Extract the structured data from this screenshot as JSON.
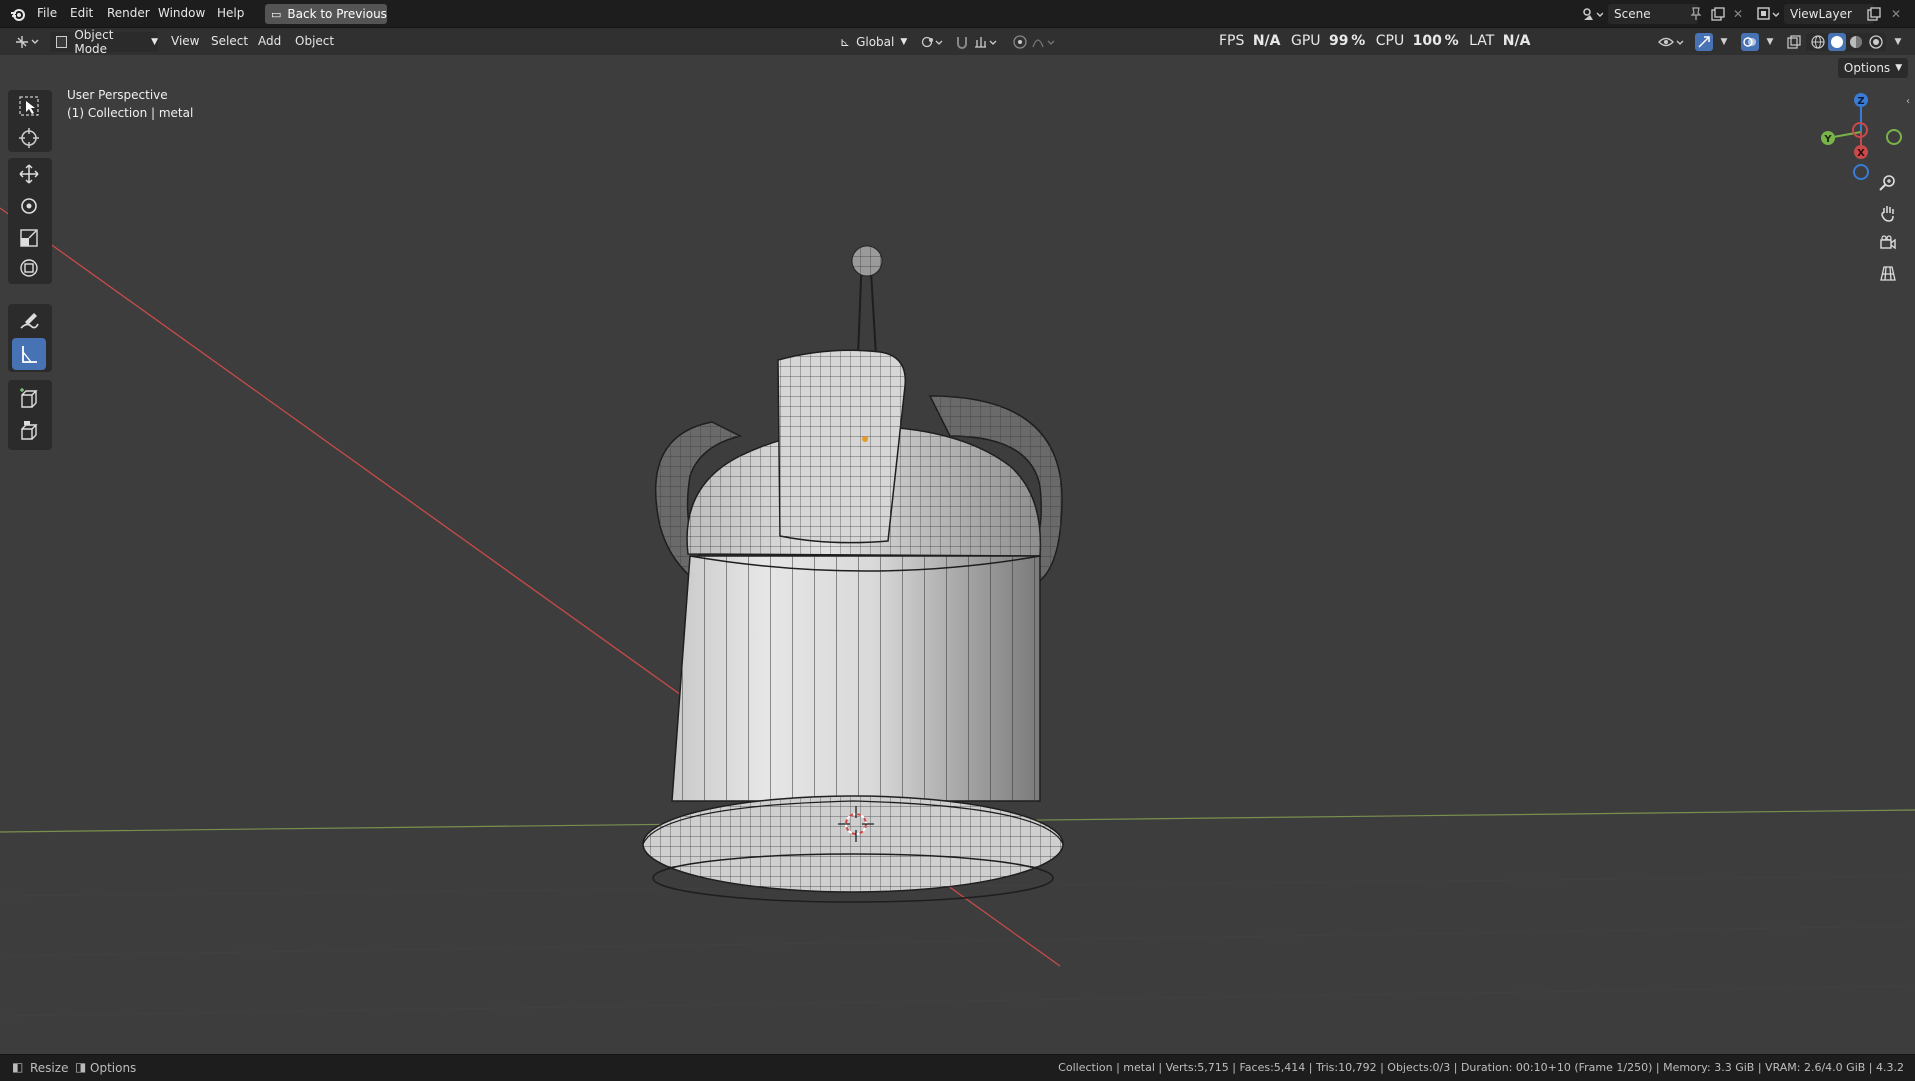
{
  "menubar": {
    "items": [
      "File",
      "Edit",
      "Render",
      "Window",
      "Help"
    ],
    "back_button": "Back to Previous",
    "scene": "Scene",
    "view_layer": "ViewLayer"
  },
  "header": {
    "mode": "Object Mode",
    "menus": [
      "View",
      "Select",
      "Add",
      "Object"
    ],
    "orientation": "Global",
    "options": "Options"
  },
  "stats": {
    "fps_label": "FPS",
    "fps_value": "N/A",
    "gpu_label": "GPU",
    "gpu_value": "99 %",
    "cpu_label": "CPU",
    "cpu_value": "100 %",
    "lat_label": "LAT",
    "lat_value": "N/A"
  },
  "viewport": {
    "view_name": "User Perspective",
    "collection": "(1) Collection | metal"
  },
  "gizmo": {
    "z": "Z",
    "y": "Y",
    "x": "X"
  },
  "statusbar": {
    "resize": "Resize",
    "options": "Options",
    "info": "Collection | metal | Verts:5,715 | Faces:5,414 | Tris:10,792 | Objects:0/3 | Duration: 00:10+10 (Frame 1/250) | Memory: 3.3 GiB | VRAM: 2.6/4.0 GiB | 4.3.2"
  },
  "colors": {
    "background": "#3d3d3d",
    "active_tool": "#4772b3",
    "axis_x": "#c84a4a",
    "axis_y": "#7a8f4e"
  }
}
